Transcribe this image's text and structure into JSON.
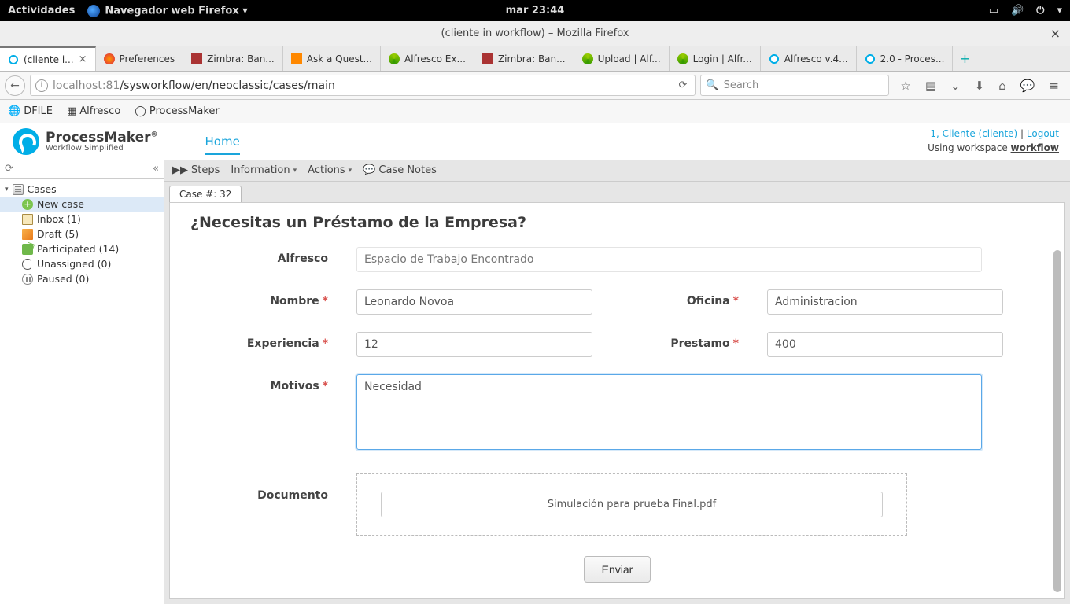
{
  "gnome": {
    "activities": "Actividades",
    "app": "Navegador web Firefox ▾",
    "clock": "mar 23:44"
  },
  "window": {
    "title": "(cliente in workflow) – Mozilla Firefox"
  },
  "tabs": [
    {
      "label": "(cliente i...",
      "icon": "pm",
      "active": true,
      "closable": true
    },
    {
      "label": "Preferences",
      "icon": "ff"
    },
    {
      "label": "Zimbra: Ban...",
      "icon": "zimbra"
    },
    {
      "label": "Ask a Quest...",
      "icon": "se"
    },
    {
      "label": "Alfresco Ex...",
      "icon": "alf"
    },
    {
      "label": "Zimbra: Ban...",
      "icon": "zimbra"
    },
    {
      "label": "Upload | Alf...",
      "icon": "alf"
    },
    {
      "label": "Login | Alfr...",
      "icon": "alf"
    },
    {
      "label": "Alfresco v.4...",
      "icon": "pm"
    },
    {
      "label": "2.0 - Proces...",
      "icon": "pm"
    }
  ],
  "url": {
    "host": "localhost",
    "port": ":81",
    "path": "/sysworkflow/en/neoclassic/cases/main"
  },
  "search_placeholder": "Search",
  "bookmarks": [
    {
      "label": "DFILE"
    },
    {
      "label": "Alfresco"
    },
    {
      "label": "ProcessMaker"
    }
  ],
  "app": {
    "brand_name": "ProcessMaker",
    "brand_tag": "Workflow Simplified",
    "nav_home": "Home",
    "user_line": "1, Cliente (cliente)",
    "logout": "Logout",
    "workspace_prefix": "Using workspace ",
    "workspace": "workflow"
  },
  "sidebar": {
    "root": "Cases",
    "items": [
      {
        "icon": "plus",
        "label": "New case",
        "selected": true
      },
      {
        "icon": "inbox",
        "label": "Inbox (1)"
      },
      {
        "icon": "draft",
        "label": "Draft (5)"
      },
      {
        "icon": "part",
        "label": "Participated (14)"
      },
      {
        "icon": "unassigned",
        "label": "Unassigned (0)"
      },
      {
        "icon": "paused",
        "label": "Paused (0)"
      }
    ]
  },
  "case_toolbar": {
    "steps": "Steps",
    "information": "Information",
    "actions": "Actions",
    "notes": "Case Notes"
  },
  "case_tab": "Case #: 32",
  "form": {
    "title": "¿Necesitas un Préstamo de la Empresa?",
    "alfresco_label": "Alfresco",
    "alfresco_value": "Espacio de Trabajo Encontrado",
    "nombre_label": "Nombre",
    "nombre_value": "Leonardo Novoa",
    "oficina_label": "Oficina",
    "oficina_value": "Administracion",
    "experiencia_label": "Experiencia",
    "experiencia_value": "12",
    "prestamo_label": "Prestamo",
    "prestamo_value": "400",
    "motivos_label": "Motivos",
    "motivos_value": "Necesidad",
    "documento_label": "Documento",
    "documento_file": "Simulación para prueba Final.pdf",
    "submit": "Enviar"
  }
}
